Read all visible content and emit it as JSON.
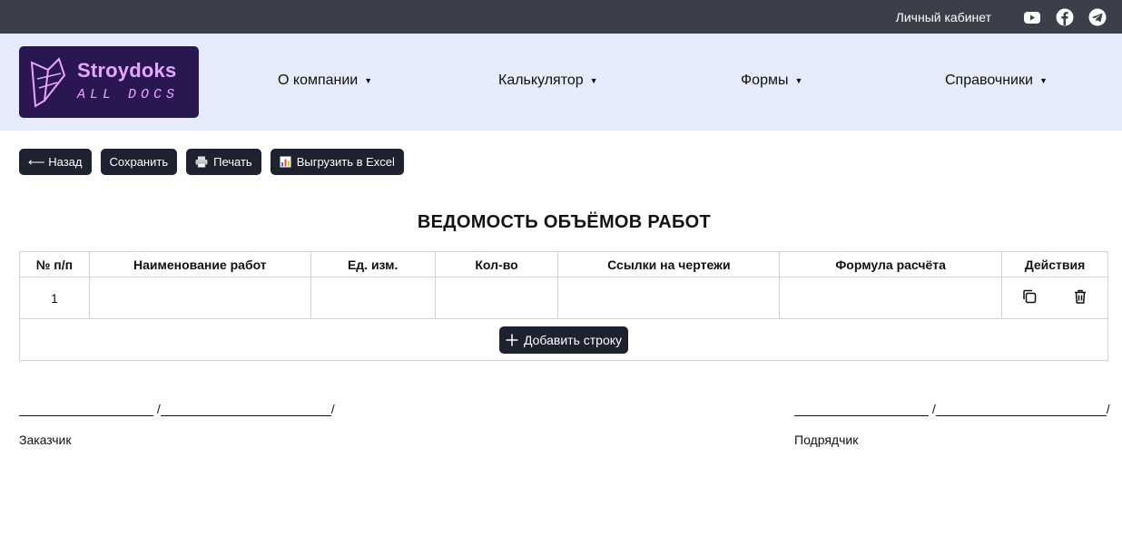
{
  "topbar": {
    "cabinet_label": "Личный кабинет",
    "icons": [
      "youtube-icon",
      "facebook-icon",
      "telegram-icon"
    ]
  },
  "logo": {
    "brand": "Stroydoks",
    "tagline": "ALL DOCS"
  },
  "nav": {
    "about": "О компании",
    "calculator": "Калькулятор",
    "forms": "Формы",
    "references": "Справочники"
  },
  "toolbar": {
    "back": "⟵ Назад",
    "save": "Сохранить",
    "print": "Печать",
    "excel": "Выгрузить в Excel"
  },
  "document": {
    "title": "ВЕДОМОСТЬ ОБЪЁМОВ РАБОТ"
  },
  "table": {
    "headers": [
      "№ п/п",
      "Наименование работ",
      "Ед. изм.",
      "Кол-во",
      "Ссылки на чертежи",
      "Формула расчёта",
      "Действия"
    ],
    "rows": [
      {
        "num": "1",
        "name": "",
        "unit": "",
        "qty": "",
        "drawings": "",
        "formula": ""
      }
    ],
    "add_row": "Добавить строку"
  },
  "signatures": {
    "customer": "Заказчик",
    "contractor": "Подрядчик"
  },
  "colors": {
    "topbar": "#3b3f4a",
    "navbar": "#e6ecfb",
    "button": "#1e2130",
    "logo_bg": "#2a1650",
    "logo_text": "#e9a6ff"
  }
}
